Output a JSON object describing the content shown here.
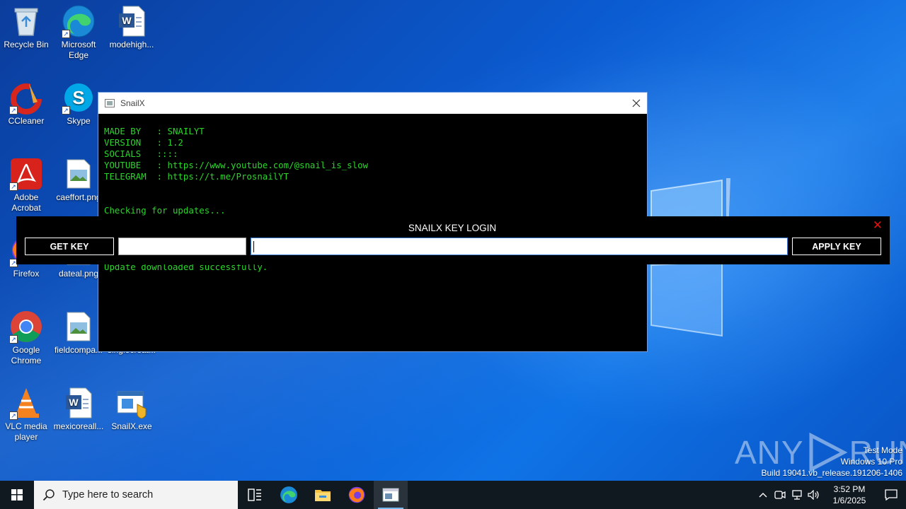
{
  "desktop": {
    "icons": [
      {
        "label": "Recycle Bin"
      },
      {
        "label": "Microsoft Edge"
      },
      {
        "label": "modehigh..."
      },
      {
        "label": "CCleaner"
      },
      {
        "label": "Skype"
      },
      {
        "label": "Adobe Acrobat"
      },
      {
        "label": "caeffort.png"
      },
      {
        "label": "Firefox"
      },
      {
        "label": "dateal.png"
      },
      {
        "label": "Google Chrome"
      },
      {
        "label": "fieldcompa..."
      },
      {
        "label": "singlecreat..."
      },
      {
        "label": "VLC media player"
      },
      {
        "label": "mexicoreall..."
      },
      {
        "label": "SnailX.exe"
      }
    ]
  },
  "console": {
    "title": "SnailX",
    "lines": [
      "MADE BY   : SNAILYT",
      "VERSION   : 1.2",
      "SOCIALS   ::::",
      "YOUTUBE   : https://www.youtube.com/@snail_is_slow",
      "TELEGRAM  : https://t.me/ProsnailYT",
      "",
      "",
      "Checking for updates...",
      "",
      "",
      "",
      "",
      "Update downloaded successfully."
    ]
  },
  "keylogin": {
    "title": "SNAILX KEY LOGIN",
    "close_label": "✕",
    "get_key_label": "GET KEY",
    "apply_key_label": "APPLY KEY",
    "small_input_value": "",
    "key_input_value": ""
  },
  "watermark": {
    "brand_left": "ANY",
    "brand_right": "RUN",
    "test_mode": "Test Mode",
    "os_edition": "Windows 10 Pro",
    "build": "Build 19041.vb_release.191206-1406"
  },
  "taskbar": {
    "search_placeholder": "Type here to search",
    "time": "3:52 PM",
    "date": "1/6/2025"
  },
  "colors": {
    "console_text": "#2bd62b",
    "close_red": "#e01010",
    "taskbar_bg": "#101820"
  }
}
